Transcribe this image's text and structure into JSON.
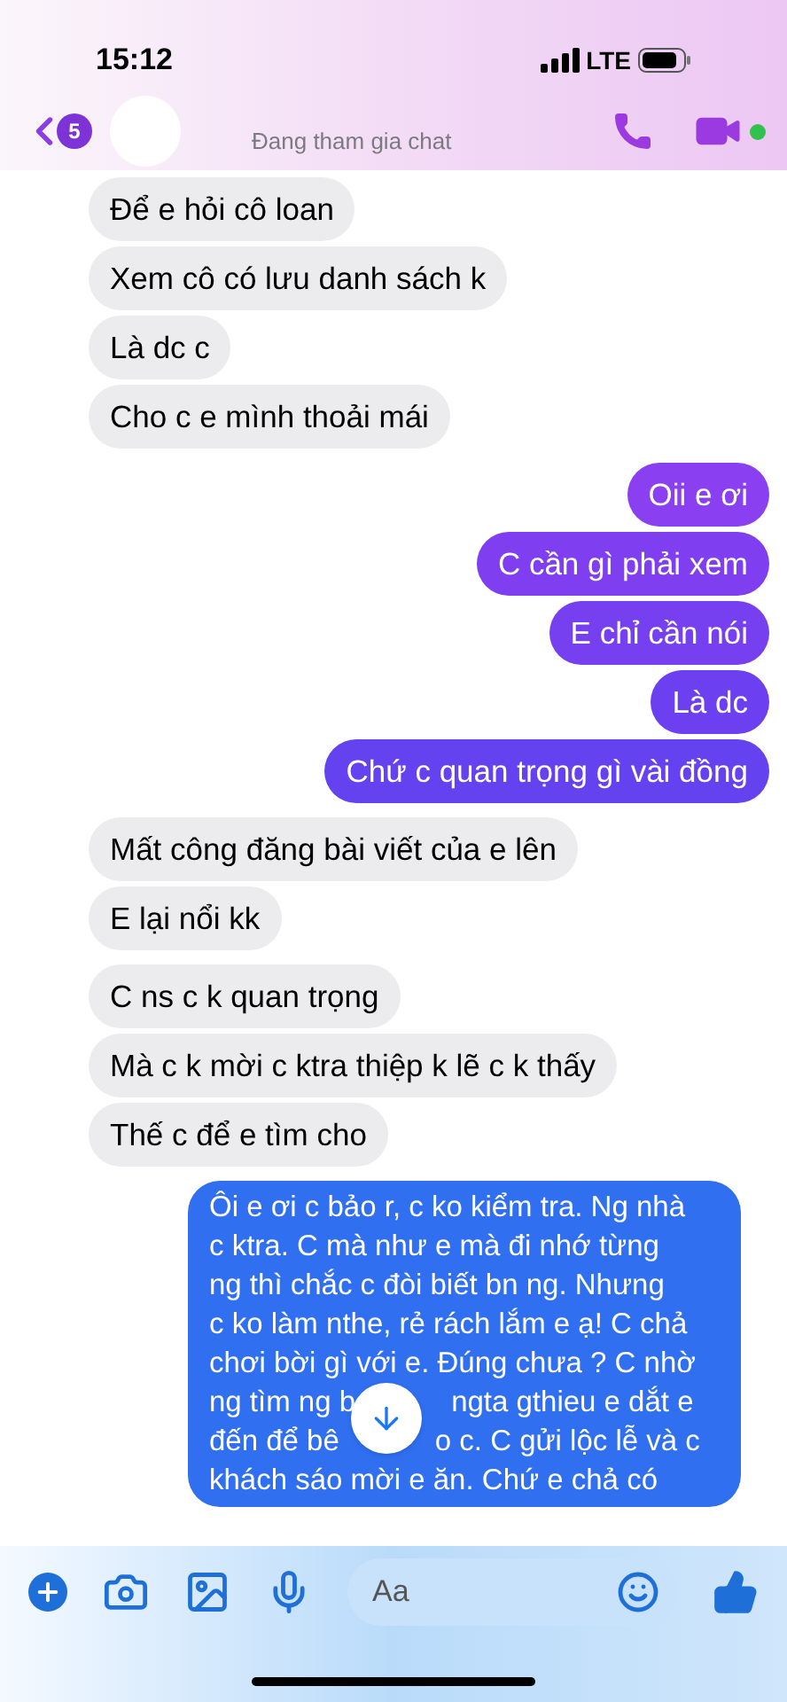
{
  "status_bar": {
    "time": "15:12",
    "network": "LTE"
  },
  "header": {
    "unread_badge": "5",
    "status": "Đang tham gia chat",
    "online": true
  },
  "groups": [
    {
      "kind": "incoming",
      "messages": [
        {
          "text": "Để e hỏi cô loan"
        },
        {
          "text": "Xem cô có lưu danh sách k"
        },
        {
          "text": "Là dc c"
        },
        {
          "text": "Cho c e mình thoải mái"
        }
      ]
    },
    {
      "kind": "outgoing",
      "messages": [
        {
          "text": "Oii e ơi",
          "color": "#8a3ff0"
        },
        {
          "text": "C cần gì phải xem",
          "color": "#7f3ff0"
        },
        {
          "text": "E chỉ cần nói",
          "color": "#763ff0"
        },
        {
          "text": "Là dc",
          "color": "#6c40f0"
        },
        {
          "text": "Chứ c quan trọng gì vài đồng",
          "color": "#6442f0"
        }
      ]
    },
    {
      "kind": "incoming",
      "messages": [
        {
          "text": "Mất công đăng bài viết của e lên"
        },
        {
          "text": "E lại nổi kk"
        }
      ]
    },
    {
      "kind": "incoming",
      "messages": [
        {
          "text": "C ns c k quan trọng"
        },
        {
          "text": "Mà c k mời c ktra thiệp k lẽ c k thấy"
        },
        {
          "text": "Thế c để e  tìm cho"
        }
      ]
    },
    {
      "kind": "outgoing",
      "messages": [
        {
          "color": "#2f6ff0",
          "lines": [
            [
              "Ôi e ơi c bảo r, c ko kiểm tra. Ng nhà"
            ],
            [
              "c ktra. C mà như e mà đi nhớ từng"
            ],
            [
              "ng thì chắc c đòi biết bn ng. Nhưng"
            ],
            [
              "c ko làm nthe, rẻ rách lắm e ạ! C chả"
            ],
            [
              "chơi bời gì với e. Đúng chưa ? C nhờ"
            ],
            [
              "ng tìm ng b",
              "ngta gthieu e dắt e"
            ],
            [
              "đến để bê",
              "o c. C gửi lộc lễ và c"
            ],
            [
              "khách sáo mời e ăn. Chứ e chả có"
            ]
          ]
        }
      ]
    }
  ],
  "composer": {
    "placeholder": "Aa"
  }
}
